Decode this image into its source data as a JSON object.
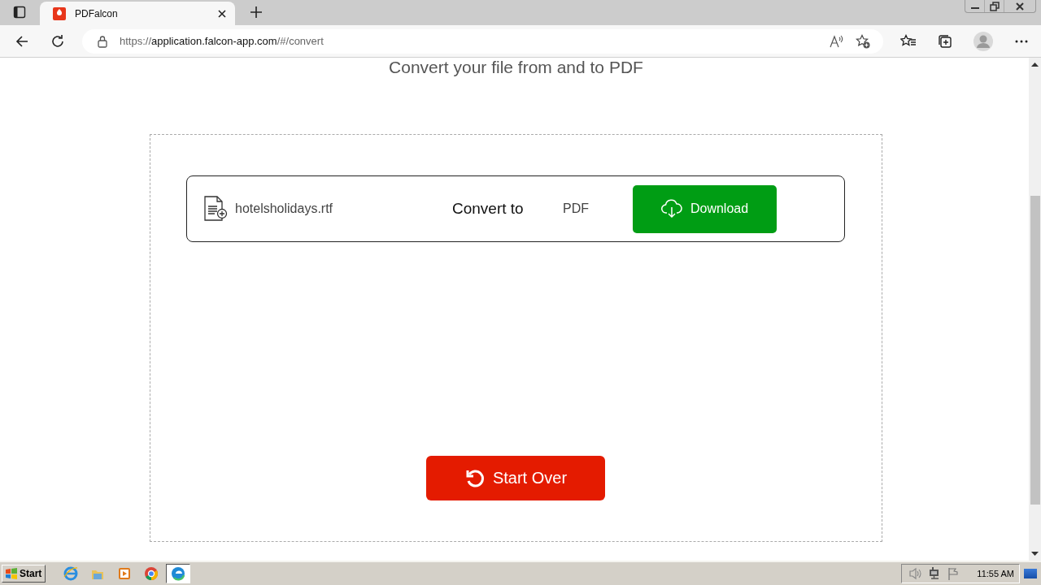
{
  "browser": {
    "tabs": [
      {
        "title": "PDFalcon",
        "selected": true
      }
    ],
    "address": {
      "scheme": "https://",
      "host": "application.falcon-app.com",
      "path": "/#/convert"
    }
  },
  "page": {
    "heading": "Convert your file from and to PDF",
    "file_row": {
      "file_name": "hotelsholidays.rtf",
      "convert_label": "Convert to",
      "target_format": "PDF",
      "download_button": "Download"
    },
    "start_over_button": "Start Over"
  },
  "taskbar": {
    "start": "Start",
    "apps": [
      {
        "kind": "ie",
        "selected": false
      },
      {
        "kind": "folder",
        "selected": false
      },
      {
        "kind": "media",
        "selected": false
      },
      {
        "kind": "chrome",
        "selected": false
      },
      {
        "kind": "edge",
        "selected": true
      }
    ],
    "clock": "11:55 AM"
  }
}
